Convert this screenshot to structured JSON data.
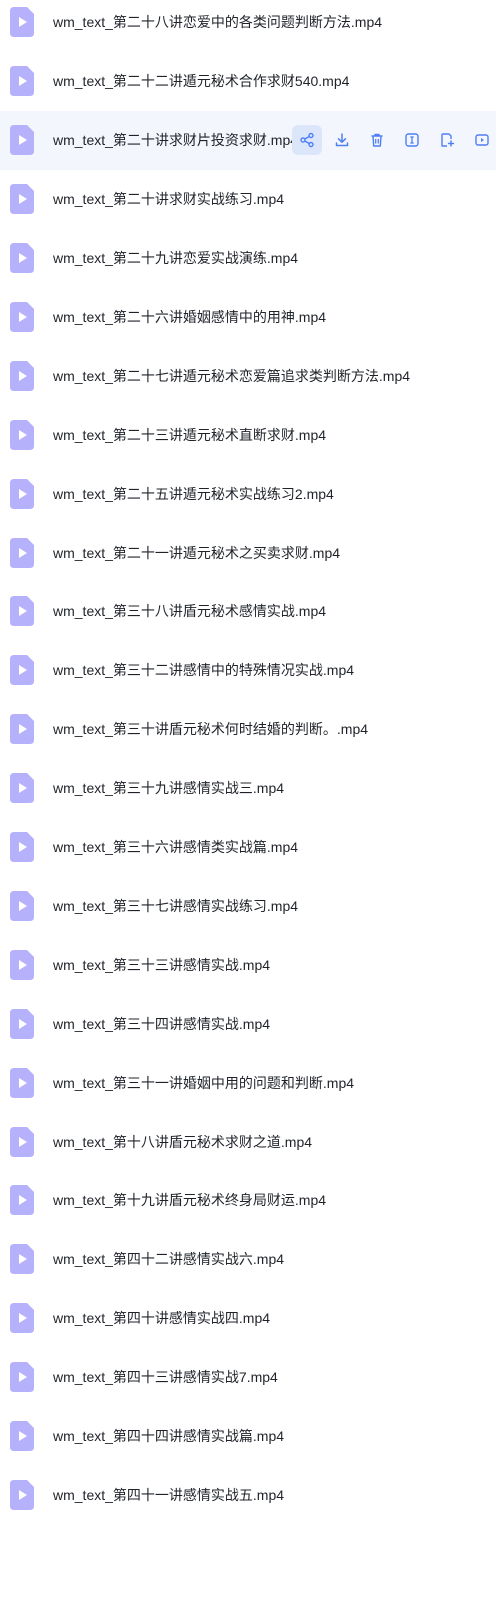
{
  "accent_color": "#4f7ff5",
  "icon_color": "#b5b1fb",
  "files": [
    {
      "name": "wm_text_第二十八讲恋爱中的各类问题判断方法.mp4"
    },
    {
      "name": "wm_text_第二十二讲遁元秘术合作求财540.mp4"
    },
    {
      "name": "wm_text_第二十讲求财片投资求财.mp4"
    },
    {
      "name": "wm_text_第二十讲求财实战练习.mp4"
    },
    {
      "name": "wm_text_第二十九讲恋爱实战演练.mp4"
    },
    {
      "name": "wm_text_第二十六讲婚姻感情中的用神.mp4"
    },
    {
      "name": "wm_text_第二十七讲遁元秘术恋爱篇追求类判断方法.mp4"
    },
    {
      "name": "wm_text_第二十三讲遁元秘术直断求财.mp4"
    },
    {
      "name": "wm_text_第二十五讲遁元秘术实战练习2.mp4"
    },
    {
      "name": "wm_text_第二十一讲遁元秘术之买卖求财.mp4"
    },
    {
      "name": "wm_text_第三十八讲盾元秘术感情实战.mp4"
    },
    {
      "name": "wm_text_第三十二讲感情中的特殊情况实战.mp4"
    },
    {
      "name": "wm_text_第三十讲盾元秘术何时结婚的判断。.mp4"
    },
    {
      "name": "wm_text_第三十九讲感情实战三.mp4"
    },
    {
      "name": "wm_text_第三十六讲感情类实战篇.mp4"
    },
    {
      "name": "wm_text_第三十七讲感情实战练习.mp4"
    },
    {
      "name": "wm_text_第三十三讲感情实战.mp4"
    },
    {
      "name": "wm_text_第三十四讲感情实战.mp4"
    },
    {
      "name": "wm_text_第三十一讲婚姻中用的问题和判断.mp4"
    },
    {
      "name": "wm_text_第十八讲盾元秘术求财之道.mp4"
    },
    {
      "name": "wm_text_第十九讲盾元秘术终身局财运.mp4"
    },
    {
      "name": "wm_text_第四十二讲感情实战六.mp4"
    },
    {
      "name": "wm_text_第四十讲感情实战四.mp4"
    },
    {
      "name": "wm_text_第四十三讲感情实战7.mp4"
    },
    {
      "name": "wm_text_第四十四讲感情实战篇.mp4"
    },
    {
      "name": "wm_text_第四十一讲感情实战五.mp4"
    }
  ],
  "active_row_index": 2,
  "actions": [
    {
      "icon": "share-icon",
      "selected": true
    },
    {
      "icon": "download-icon",
      "selected": false
    },
    {
      "icon": "trash-icon",
      "selected": false
    },
    {
      "icon": "rename-icon",
      "selected": false
    },
    {
      "icon": "copy-to-icon",
      "selected": false
    },
    {
      "icon": "more-icon",
      "selected": false
    }
  ]
}
